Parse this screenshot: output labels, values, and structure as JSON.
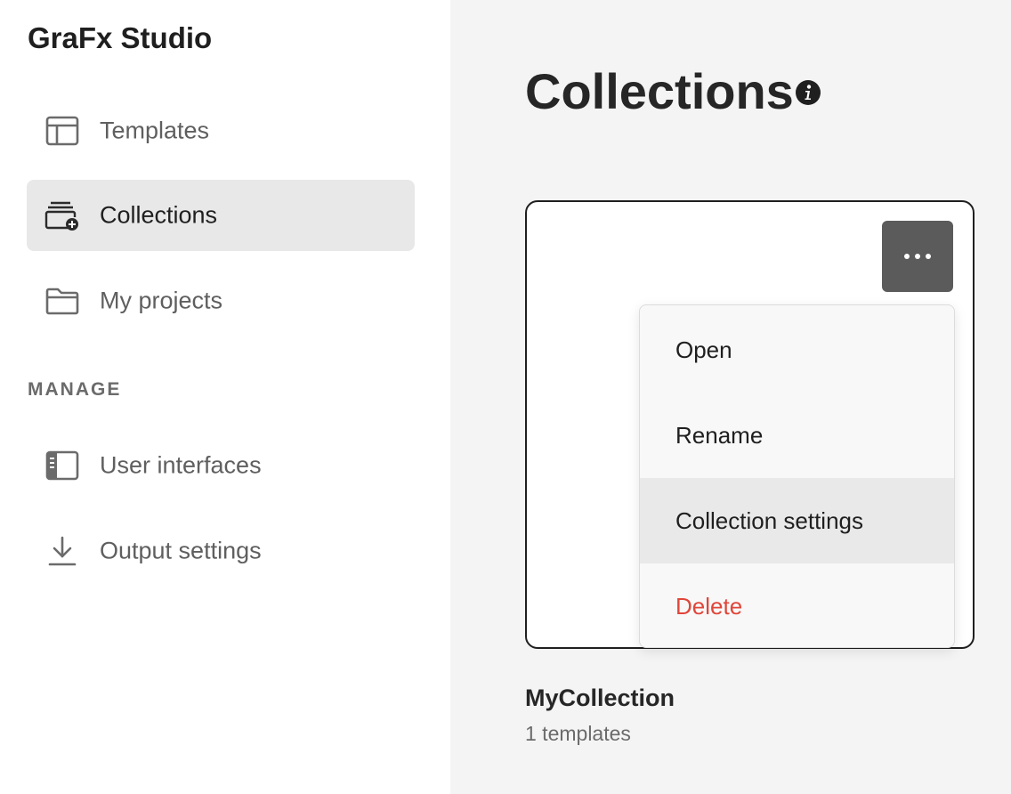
{
  "app": {
    "title": "GraFx Studio"
  },
  "sidebar": {
    "items": [
      {
        "label": "Templates",
        "icon": "layout-icon",
        "active": false
      },
      {
        "label": "Collections",
        "icon": "collection-add-icon",
        "active": true
      },
      {
        "label": "My projects",
        "icon": "folder-icon",
        "active": false
      }
    ],
    "manage_label": "MANAGE",
    "manage_items": [
      {
        "label": "User interfaces",
        "icon": "user-interface-icon"
      },
      {
        "label": "Output settings",
        "icon": "download-icon"
      }
    ]
  },
  "main": {
    "title": "Collections",
    "info_icon": "info-icon",
    "card": {
      "name": "MyCollection",
      "meta": "1 templates",
      "more_icon": "more-horizontal-icon"
    },
    "menu": {
      "items": [
        {
          "label": "Open"
        },
        {
          "label": "Rename"
        },
        {
          "label": "Collection settings",
          "highlighted": true
        },
        {
          "label": "Delete",
          "danger": true,
          "color": "#e0463a"
        }
      ]
    }
  },
  "colors": {
    "sidebar_active_bg": "#e8e8e8",
    "main_bg": "#f4f4f4",
    "more_button_bg": "#5b5b5b",
    "danger": "#e0463a"
  }
}
